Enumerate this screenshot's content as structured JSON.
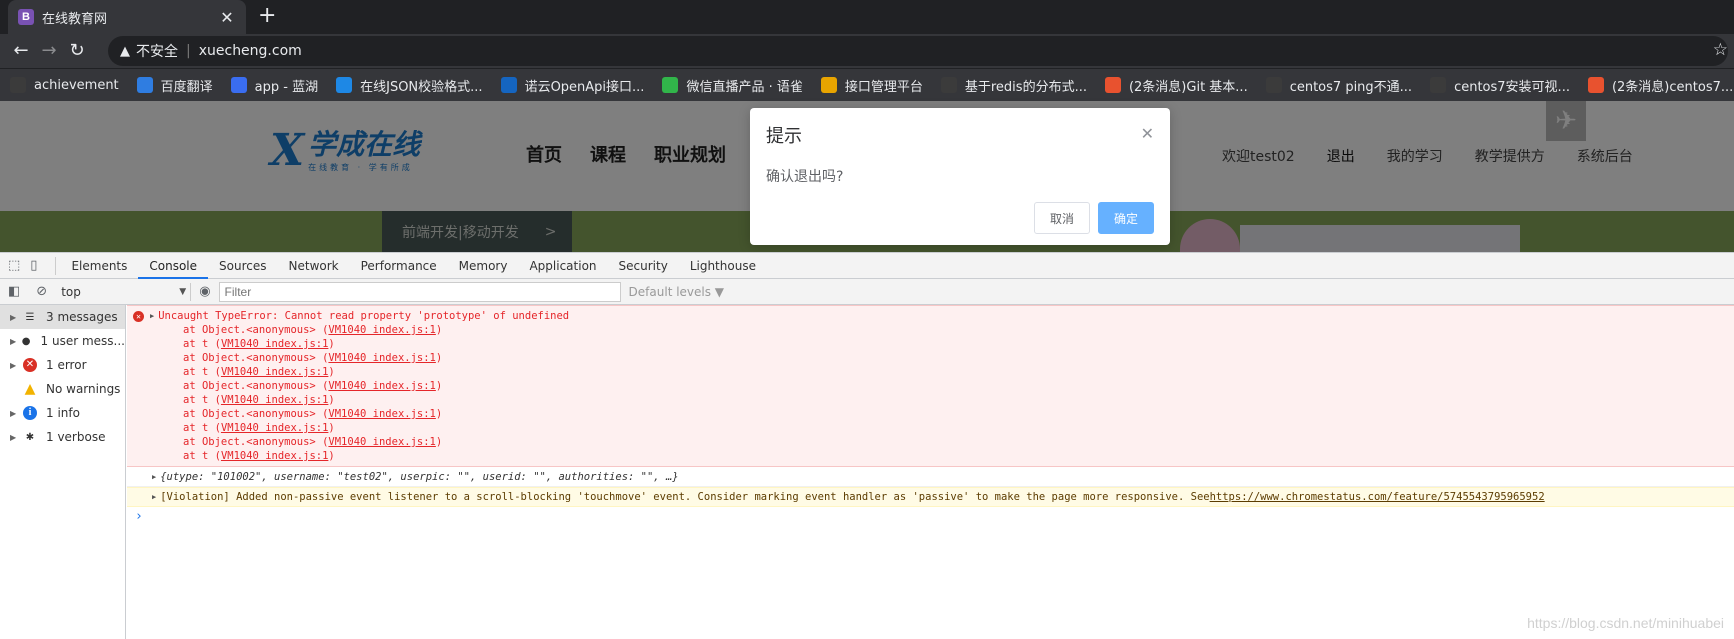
{
  "browser": {
    "tab_title": "在线教育网",
    "tab_favicon_letter": "B",
    "url": "xuecheng.com",
    "security_label": "不安全",
    "bookmarks": [
      {
        "label": "achievement",
        "color": "#3b3b3b"
      },
      {
        "label": "百度翻译",
        "color": "#2f7de1"
      },
      {
        "label": "app - 蓝湖",
        "color": "#3a6df0"
      },
      {
        "label": "在线JSON校验格式...",
        "color": "#1e88e5"
      },
      {
        "label": "诺云OpenApi接口...",
        "color": "#1565c0"
      },
      {
        "label": "微信直播产品 · 语雀",
        "color": "#31b54a"
      },
      {
        "label": "接口管理平台",
        "color": "#e8a400"
      },
      {
        "label": "基于redis的分布式...",
        "color": "#3b3b3b"
      },
      {
        "label": "(2条消息)Git 基本...",
        "color": "#e8522f"
      },
      {
        "label": "centos7 ping不通...",
        "color": "#3b3b3b"
      },
      {
        "label": "centos7安装可视...",
        "color": "#3b3b3b"
      },
      {
        "label": "(2条消息)centos7...",
        "color": "#e8522f"
      }
    ]
  },
  "site": {
    "logo_main": "学成在线",
    "logo_sub": "在线教育 · 学有所成",
    "nav": [
      "首页",
      "课程",
      "职业规划"
    ],
    "user_nav": {
      "welcome": "欢迎test02",
      "logout": "退出",
      "my_learning": "我的学习",
      "teach": "教学提供方",
      "admin": "系统后台"
    },
    "banner_menu": "前端开发|移动开发",
    "banner_arrow": ">"
  },
  "dialog": {
    "title": "提示",
    "message": "确认退出吗?",
    "cancel": "取消",
    "confirm": "确定"
  },
  "devtools": {
    "tabs": [
      "Elements",
      "Console",
      "Sources",
      "Network",
      "Performance",
      "Memory",
      "Application",
      "Security",
      "Lighthouse"
    ],
    "active_tab": "Console",
    "context": "top",
    "filter_placeholder": "Filter",
    "levels": "Default levels ▼",
    "sidebar": [
      {
        "label": "3 messages",
        "icon": "list-icon"
      },
      {
        "label": "1 user mess...",
        "icon": "user-icon"
      },
      {
        "label": "1 error",
        "icon": "error-icon"
      },
      {
        "label": "No warnings",
        "icon": "warning-icon"
      },
      {
        "label": "1 info",
        "icon": "info-icon"
      },
      {
        "label": "1 verbose",
        "icon": "bug-icon"
      }
    ],
    "error": {
      "message": "Uncaught TypeError: Cannot read property 'prototype' of undefined",
      "stack": [
        {
          "prefix": "at Object.<anonymous> (",
          "link": "VM1040 index.js:1",
          "suffix": ")"
        },
        {
          "prefix": "at t (",
          "link": "VM1040 index.js:1",
          "suffix": ")"
        },
        {
          "prefix": "at Object.<anonymous> (",
          "link": "VM1040 index.js:1",
          "suffix": ")"
        },
        {
          "prefix": "at t (",
          "link": "VM1040 index.js:1",
          "suffix": ")"
        },
        {
          "prefix": "at Object.<anonymous> (",
          "link": "VM1040 index.js:1",
          "suffix": ")"
        },
        {
          "prefix": "at t (",
          "link": "VM1040 index.js:1",
          "suffix": ")"
        },
        {
          "prefix": "at Object.<anonymous> (",
          "link": "VM1040 index.js:1",
          "suffix": ")"
        },
        {
          "prefix": "at t (",
          "link": "VM1040 index.js:1",
          "suffix": ")"
        },
        {
          "prefix": "at Object.<anonymous> (",
          "link": "VM1040 index.js:1",
          "suffix": ")"
        },
        {
          "prefix": "at t (",
          "link": "VM1040 index.js:1",
          "suffix": ")"
        }
      ]
    },
    "object_log": "{utype: \"101002\", username: \"test02\", userpic: \"\", userid: \"\", authorities: \"\", …}",
    "violation": "[Violation] Added non-passive event listener to a scroll-blocking 'touchmove' event. Consider marking event handler as 'passive' to make the page more responsive. See ",
    "violation_link": "https://www.chromestatus.com/feature/5745543795965952",
    "watermark": "https://blog.csdn.net/minihuabei"
  }
}
